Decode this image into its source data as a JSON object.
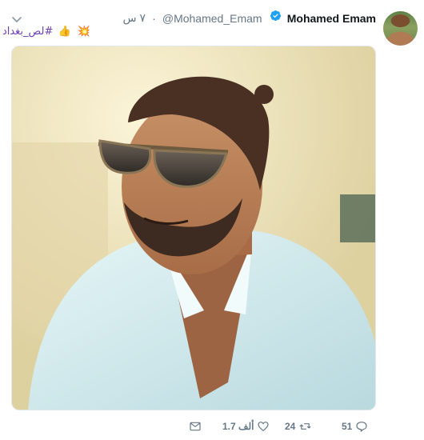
{
  "author": {
    "name": "Mohamed Emam",
    "handle": "@Mohamed_Emam",
    "separator": "·",
    "time": "٧ س",
    "verified": true
  },
  "tweet": {
    "hashtag": "#لص_بغداد",
    "emoji_1": "💥",
    "emoji_2": "👍"
  },
  "media": {
    "description_icon": "photo"
  },
  "actions": {
    "reply_count": "51",
    "retweet_count": "24",
    "like_count": "1.7 ألف"
  },
  "colors": {
    "hashtag": "#6d3fb3",
    "muted": "#657786",
    "verified": "#1da1f2"
  }
}
